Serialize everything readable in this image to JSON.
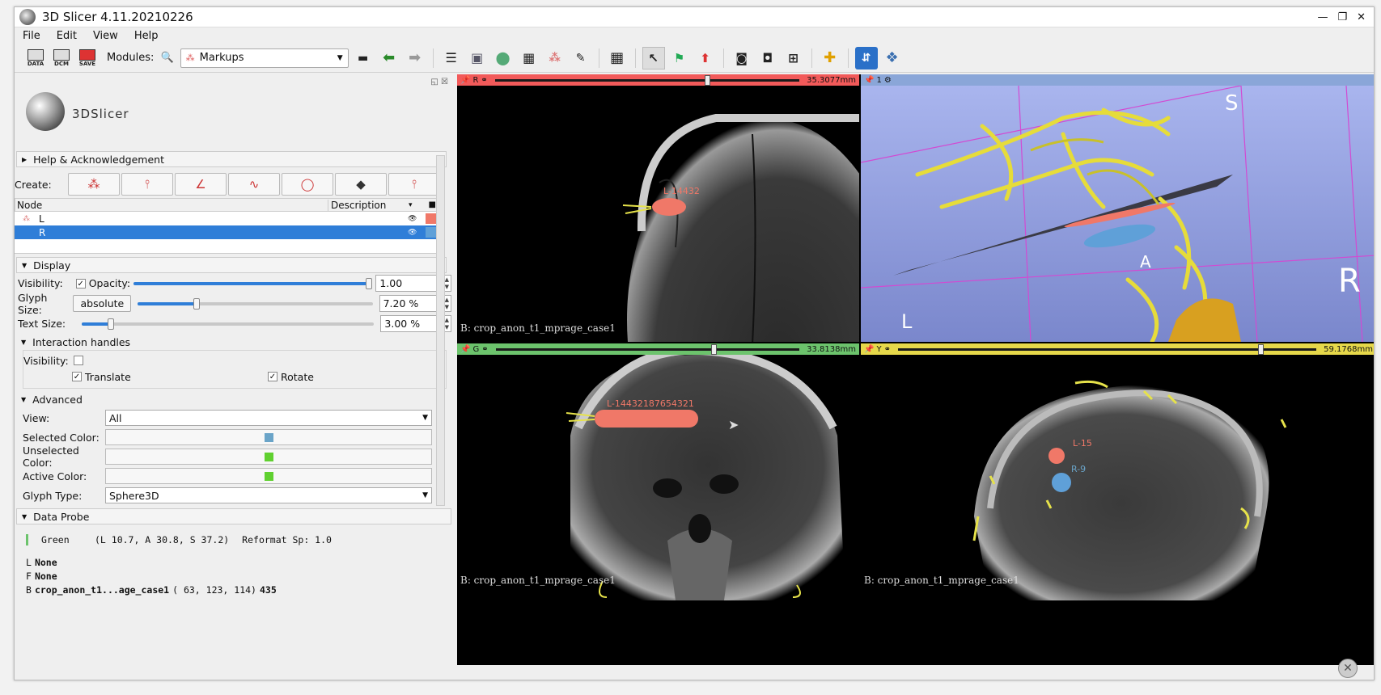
{
  "window": {
    "title": "3D Slicer 4.11.20210226",
    "controls": [
      "—",
      "❐",
      "✕"
    ]
  },
  "menu": [
    "File",
    "Edit",
    "View",
    "Help"
  ],
  "toolbar": {
    "buttons": [
      "DATA",
      "DCM",
      "SAVE"
    ],
    "modules_label": "Modules:",
    "module_selected": "Markups"
  },
  "logo_text": "3DSlicer",
  "help_section": "Help & Acknowledgement",
  "create_label": "Create:",
  "node_table": {
    "headers": [
      "Node",
      "Description"
    ],
    "rows": [
      {
        "name": "L",
        "color": "#f07868",
        "selected": false
      },
      {
        "name": "R",
        "color": "#5fa0d8",
        "selected": true
      }
    ]
  },
  "display": {
    "title": "Display",
    "visibility_label": "Visibility:",
    "opacity_label": "Opacity:",
    "opacity_value": "1.00",
    "opacity_fraction": 1.0,
    "glyph_size_label": "Glyph Size:",
    "glyph_mode": "absolute",
    "glyph_value": "7.20 %",
    "glyph_fraction": 0.25,
    "text_size_label": "Text Size:",
    "text_value": "3.00 %",
    "text_fraction": 0.1
  },
  "interaction": {
    "title": "Interaction handles",
    "visibility_label": "Visibility:",
    "translate_label": "Translate",
    "rotate_label": "Rotate"
  },
  "advanced": {
    "title": "Advanced",
    "view_label": "View:",
    "view_value": "All",
    "selected_color_label": "Selected Color:",
    "selected_color": "#6aa4c8",
    "unselected_color_label": "Unselected Color:",
    "unselected_color": "#60d030",
    "active_color_label": "Active Color:",
    "active_color": "#60d030",
    "glyph_type_label": "Glyph Type:",
    "glyph_type_value": "Sphere3D"
  },
  "data_probe": {
    "title": "Data Probe",
    "view": "Green",
    "coords": "(L 10.7, A 30.8, S 37.2)",
    "reformat": "Reformat Sp: 1.0",
    "L_label": "L",
    "L_value": "None",
    "F_label": "F",
    "F_value": "None",
    "B_label": "B",
    "B_volume": "crop_anon_t1...age_case1",
    "B_ijk": "( 63, 123, 114)",
    "B_value": "435"
  },
  "views": {
    "red": {
      "letter": "R",
      "offset": "35.3077mm",
      "color": "#f25a5a",
      "slider_fraction": 0.69,
      "label": "B: crop_anon_t1_mprage_case1",
      "markup_label": "L-14432"
    },
    "three_d": {
      "letter": "1",
      "color": "#8aa6d8",
      "orient_left": "L",
      "orient_right": "R",
      "orient_top": "S",
      "orient_ant": "A"
    },
    "green": {
      "letter": "G",
      "offset": "33.8138mm",
      "color": "#6cc36c",
      "slider_fraction": 0.71,
      "label": "B: crop_anon_t1_mprage_case1",
      "markup_label": "L-14432187654321"
    },
    "yellow": {
      "letter": "Y",
      "offset": "59.1768mm",
      "color": "#e6d84a",
      "slider_fraction": 0.86,
      "label": "B: crop_anon_t1_mprage_case1",
      "label_L": "L-15",
      "label_R": "R-9"
    }
  }
}
